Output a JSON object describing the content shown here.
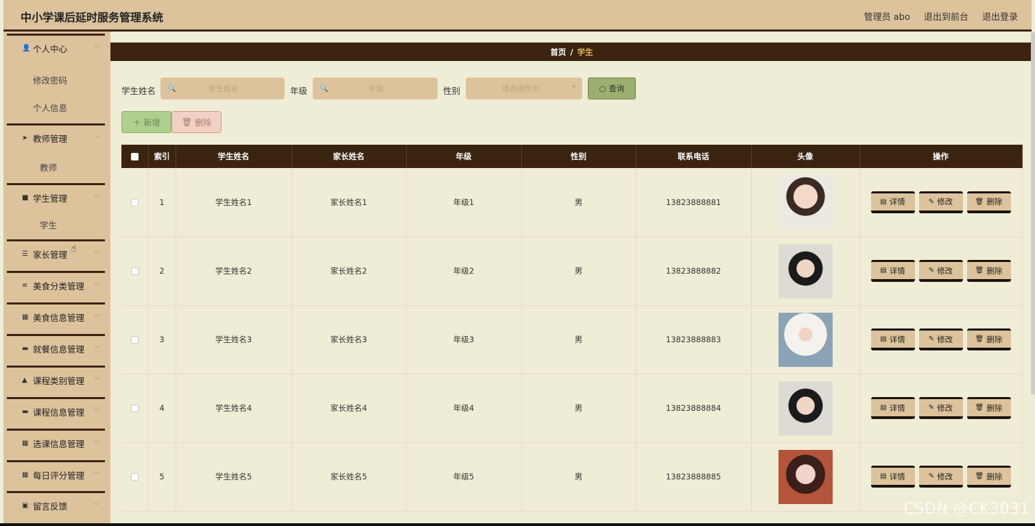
{
  "app": {
    "title": "中小学课后延时服务管理系统",
    "admin": "管理员 abo",
    "to_front": "退出到前台",
    "logout": "退出登录"
  },
  "sidebar": [
    {
      "type": "group",
      "label": "个人中心",
      "icon": "user-icon",
      "glyph": "👤"
    },
    {
      "type": "sub",
      "label": "修改密码"
    },
    {
      "type": "sub",
      "label": "个人信息"
    },
    {
      "type": "group",
      "label": "教师管理",
      "icon": "send-icon",
      "glyph": "➤"
    },
    {
      "type": "sub",
      "label": "教师"
    },
    {
      "type": "group",
      "label": "学生管理",
      "icon": "video-icon",
      "glyph": "■"
    },
    {
      "type": "sub",
      "label": "学生"
    },
    {
      "type": "group",
      "label": "家长管理",
      "icon": "sliders-icon",
      "glyph": "☰"
    },
    {
      "type": "group",
      "label": "美食分类管理",
      "icon": "menu-icon",
      "glyph": "≡"
    },
    {
      "type": "group",
      "label": "美食信息管理",
      "icon": "grid-icon",
      "glyph": "▦"
    },
    {
      "type": "group",
      "label": "就餐信息管理",
      "icon": "monitor-icon",
      "glyph": "▬"
    },
    {
      "type": "group",
      "label": "课程类别管理",
      "icon": "person-icon",
      "glyph": "▲"
    },
    {
      "type": "group",
      "label": "课程信息管理",
      "icon": "box-icon",
      "glyph": "▬"
    },
    {
      "type": "group",
      "label": "选课信息管理",
      "icon": "grid-icon",
      "glyph": "▦"
    },
    {
      "type": "group",
      "label": "每日评分管理",
      "icon": "grid-icon",
      "glyph": "▦"
    },
    {
      "type": "group",
      "label": "留言反馈",
      "icon": "clipboard-icon",
      "glyph": "▣"
    }
  ],
  "breadcrumb": {
    "home": "首页",
    "sep": "/",
    "current": "学生"
  },
  "search": {
    "name_label": "学生姓名",
    "name_placeholder": "学生姓名",
    "grade_label": "年级",
    "grade_placeholder": "年级",
    "gender_label": "性别",
    "gender_placeholder": "请选择性别",
    "query_label": "查询"
  },
  "toolbar": {
    "add_label": "新增",
    "delete_label": "删除"
  },
  "table": {
    "columns": [
      "",
      "索引",
      "学生姓名",
      "家长姓名",
      "年级",
      "性别",
      "联系电话",
      "头像",
      "操作"
    ],
    "rows": [
      {
        "index": "1",
        "student": "学生姓名1",
        "parent": "家长姓名1",
        "grade": "年级1",
        "gender": "男",
        "phone": "13823888881"
      },
      {
        "index": "2",
        "student": "学生姓名2",
        "parent": "家长姓名2",
        "grade": "年级2",
        "gender": "男",
        "phone": "13823888882"
      },
      {
        "index": "3",
        "student": "学生姓名3",
        "parent": "家长姓名3",
        "grade": "年级3",
        "gender": "男",
        "phone": "13823888883"
      },
      {
        "index": "4",
        "student": "学生姓名4",
        "parent": "家长姓名4",
        "grade": "年级4",
        "gender": "男",
        "phone": "13823888884"
      },
      {
        "index": "5",
        "student": "学生姓名5",
        "parent": "家长姓名5",
        "grade": "年级5",
        "gender": "男",
        "phone": "13823888885"
      }
    ],
    "actions": {
      "detail": "详情",
      "edit": "修改",
      "delete": "删除"
    }
  },
  "watermark": "CSDN @CK3031",
  "colors": {
    "header_bg": "#dcc39c",
    "dark_bar": "#3a2410",
    "content_bg": "#f0edd6",
    "accent_text": "#e6b454"
  }
}
